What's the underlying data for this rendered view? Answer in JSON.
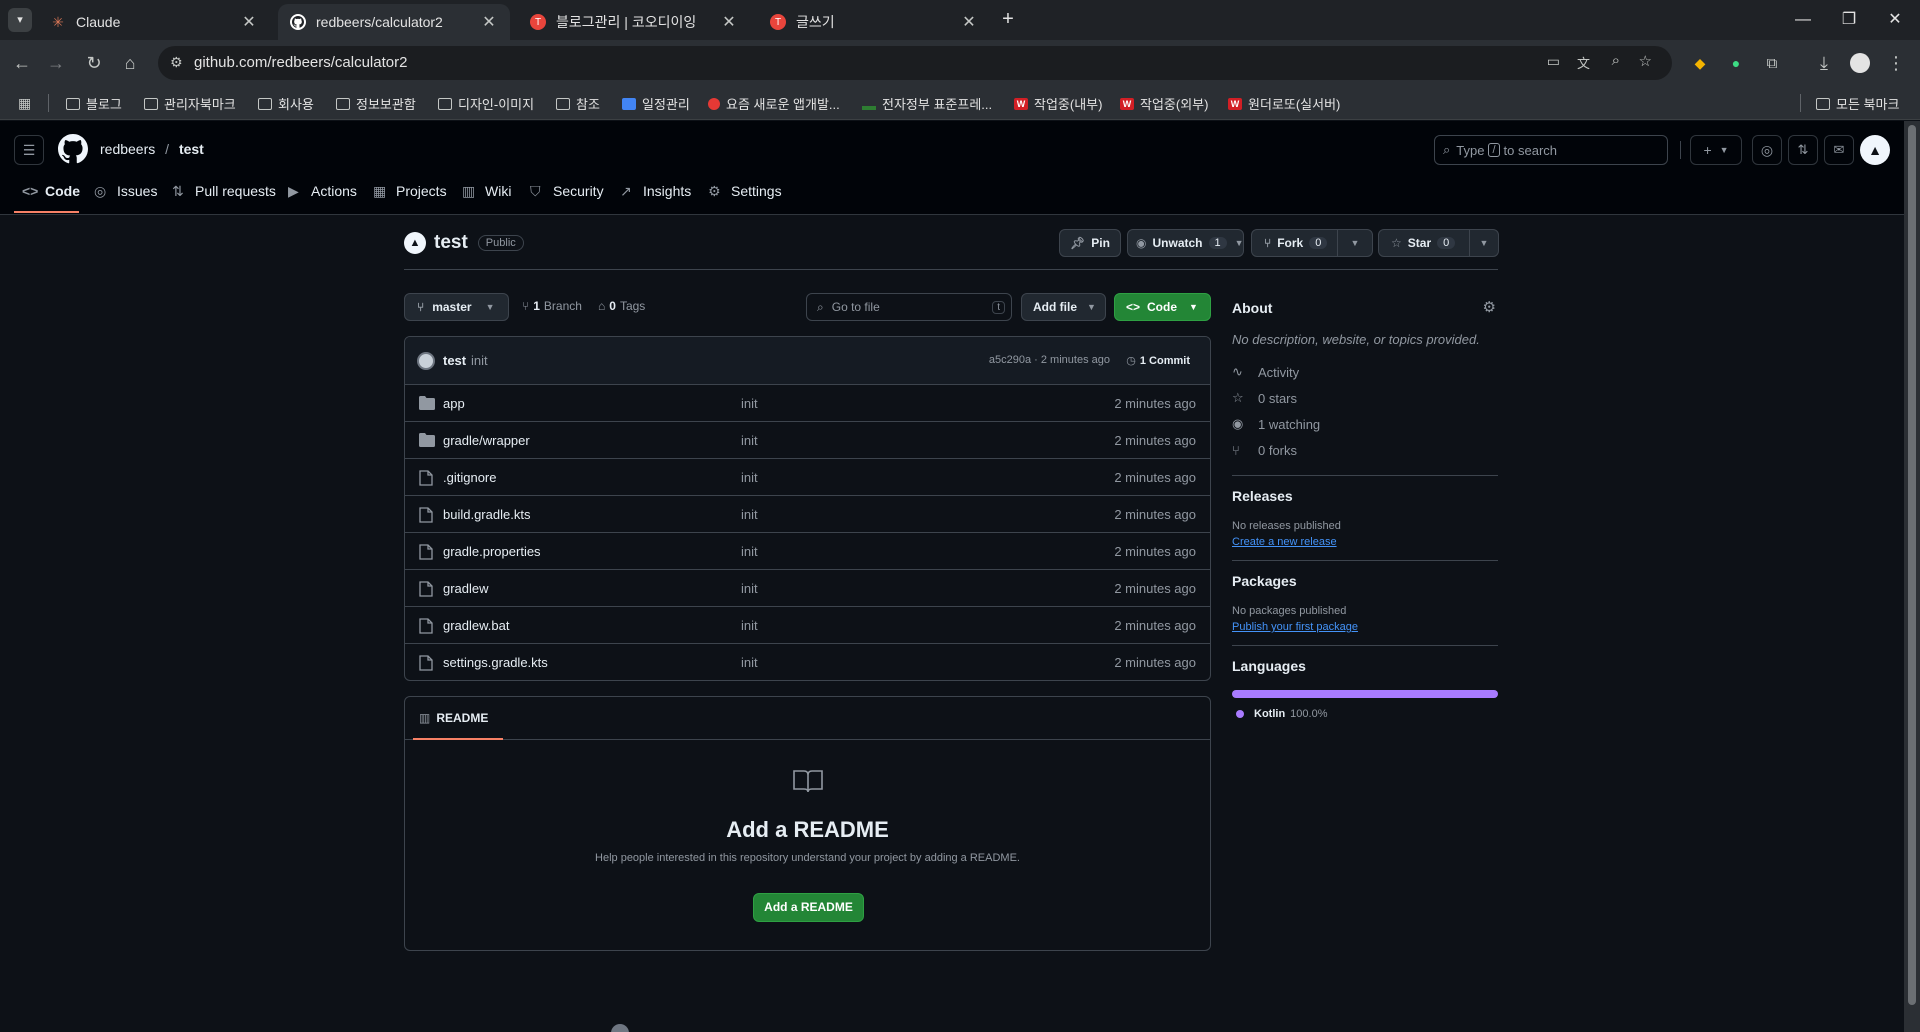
{
  "browser": {
    "tabs": [
      {
        "title": "Claude",
        "favicon": "claude-icon",
        "color": "#d97757"
      },
      {
        "title": "redbeers/calculator2",
        "favicon": "github-icon",
        "color": "#ffffff"
      },
      {
        "title": "블로그관리 | 코오디이잉",
        "favicon": "tistory-icon",
        "color": "#e8453c"
      },
      {
        "title": "글쓰기",
        "favicon": "tistory-icon",
        "color": "#e8453c"
      }
    ],
    "url": "github.com/redbeers/calculator2",
    "bookmarks": [
      {
        "label": "블로그",
        "type": "folder"
      },
      {
        "label": "관리자북마크",
        "type": "folder"
      },
      {
        "label": "회사용",
        "type": "folder"
      },
      {
        "label": "정보보관함",
        "type": "folder"
      },
      {
        "label": "디자인-이미지",
        "type": "folder"
      },
      {
        "label": "참조",
        "type": "folder"
      },
      {
        "label": "일정관리",
        "type": "calendar"
      },
      {
        "label": "요즘 새로운 앱개발...",
        "type": "tomato"
      },
      {
        "label": "전자정부 표준프레...",
        "type": "egov"
      },
      {
        "label": "작업중(내부)",
        "type": "w"
      },
      {
        "label": "작업중(외부)",
        "type": "w"
      },
      {
        "label": "원더로또(실서버)",
        "type": "w"
      }
    ],
    "all_bookmarks": "모든 북마크"
  },
  "header": {
    "owner": "redbeers",
    "sep": "/",
    "repo": "test",
    "search_placeholder": "Type / to search",
    "search_pre": "Type",
    "search_key": "/",
    "search_post": "to search",
    "nav": [
      "Code",
      "Issues",
      "Pull requests",
      "Actions",
      "Projects",
      "Wiki",
      "Security",
      "Insights",
      "Settings"
    ]
  },
  "repo": {
    "name": "test",
    "visibility": "Public",
    "pin": "Pin",
    "unwatch": "Unwatch",
    "watch_count": "1",
    "fork": "Fork",
    "fork_count": "0",
    "star": "Star",
    "star_count": "0"
  },
  "toolbar": {
    "branch": "master",
    "branch_count": "1",
    "branch_label": "Branch",
    "tag_count": "0",
    "tag_label": "Tags",
    "goto_placeholder": "Go to file",
    "goto_key": "t",
    "add_file": "Add file",
    "code": "Code"
  },
  "commit": {
    "author": "test",
    "message": "init",
    "meta": "a5c290a · 2 minutes ago",
    "count_label": "1 Commit"
  },
  "files": [
    {
      "name": "app",
      "type": "folder",
      "message": "init",
      "time": "2 minutes ago"
    },
    {
      "name": "gradle/wrapper",
      "type": "folder",
      "message": "init",
      "time": "2 minutes ago"
    },
    {
      "name": ".gitignore",
      "type": "file",
      "message": "init",
      "time": "2 minutes ago"
    },
    {
      "name": "build.gradle.kts",
      "type": "file",
      "message": "init",
      "time": "2 minutes ago"
    },
    {
      "name": "gradle.properties",
      "type": "file",
      "message": "init",
      "time": "2 minutes ago"
    },
    {
      "name": "gradlew",
      "type": "file",
      "message": "init",
      "time": "2 minutes ago"
    },
    {
      "name": "gradlew.bat",
      "type": "file",
      "message": "init",
      "time": "2 minutes ago"
    },
    {
      "name": "settings.gradle.kts",
      "type": "file",
      "message": "init",
      "time": "2 minutes ago"
    }
  ],
  "readme": {
    "tab": "README",
    "title": "Add a README",
    "desc": "Help people interested in this repository understand your project by adding a README.",
    "button": "Add a README"
  },
  "about": {
    "title": "About",
    "desc": "No description, website, or topics provided.",
    "activity": "Activity",
    "stars": "0 stars",
    "watching": "1 watching",
    "forks": "0 forks"
  },
  "releases": {
    "title": "Releases",
    "empty": "No releases published",
    "link": "Create a new release"
  },
  "packages": {
    "title": "Packages",
    "empty": "No packages published",
    "link": "Publish your first package"
  },
  "languages": {
    "title": "Languages",
    "items": [
      {
        "name": "Kotlin",
        "percent": "100.0%",
        "share": 1.0,
        "color": "#a97bff"
      }
    ]
  },
  "colors": {
    "accent_green": "#238636",
    "link_blue": "#4493f8",
    "nav_underline": "#f78166"
  }
}
